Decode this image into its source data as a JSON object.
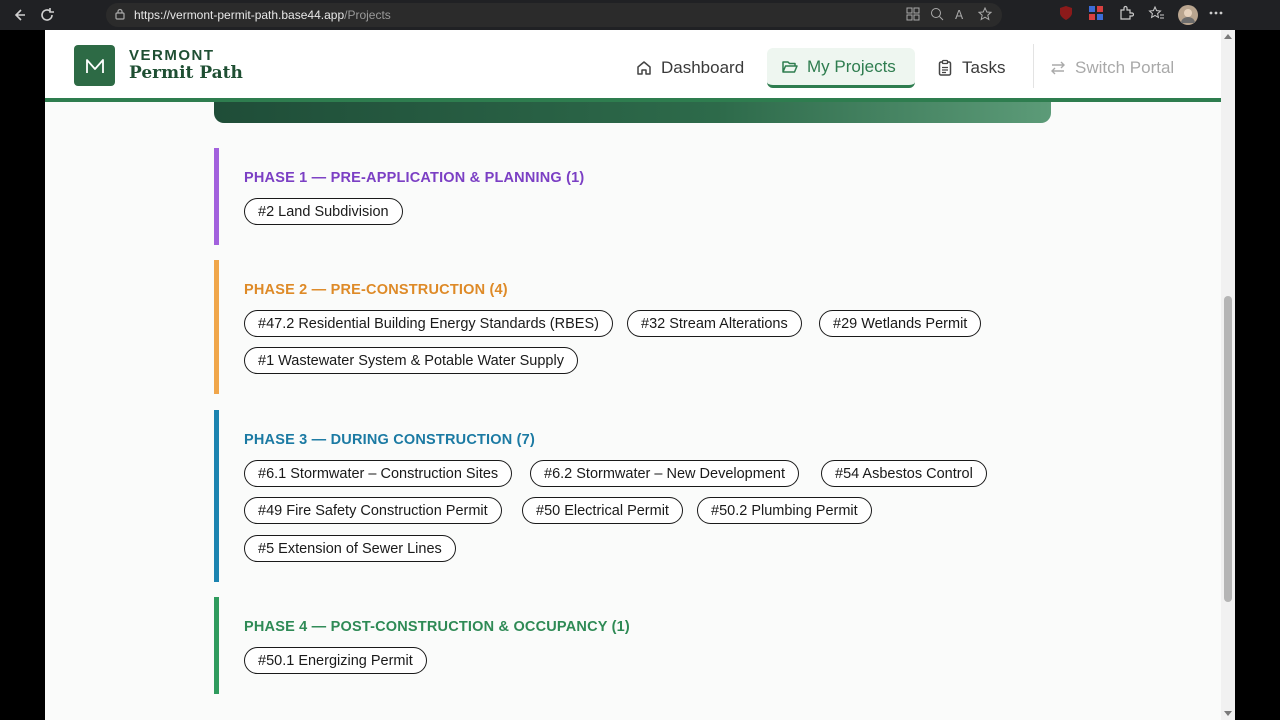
{
  "browser": {
    "url_host": "https://vermont-permit-path.base44.app",
    "url_path": "/Projects"
  },
  "brand": {
    "line1": "VERMONT",
    "line2": "Permit Path"
  },
  "nav": {
    "dashboard": "Dashboard",
    "my_projects": "My Projects",
    "tasks": "Tasks",
    "switch_portal": "Switch Portal"
  },
  "colors": {
    "brand_green": "#2e7d4f",
    "phase1": "#a261dd",
    "phase1_title": "#7b3fc4",
    "phase2": "#f0a64a",
    "phase2_title": "#de8a27",
    "phase3": "#1b84b0",
    "phase3_title": "#1b7aa3",
    "phase4": "#2f9b5d",
    "phase4_title": "#2e8a55"
  },
  "phases": [
    {
      "title": "PHASE 1 — PRE-APPLICATION & PLANNING (1)",
      "permits": [
        "#2 Land Subdivision"
      ]
    },
    {
      "title": "PHASE 2 — PRE-CONSTRUCTION (4)",
      "permits": [
        "#47.2 Residential Building Energy Standards (RBES)",
        "#32 Stream Alterations",
        "#29 Wetlands Permit",
        "#1 Wastewater System & Potable Water Supply"
      ]
    },
    {
      "title": "PHASE 3 — DURING CONSTRUCTION (7)",
      "permits": [
        "#6.1 Stormwater – Construction Sites",
        "#6.2 Stormwater – New Development",
        "#54 Asbestos Control",
        "#49 Fire Safety Construction Permit",
        "#50 Electrical Permit",
        "#50.2 Plumbing Permit",
        "#5 Extension of Sewer Lines"
      ]
    },
    {
      "title": "PHASE 4 — POST-CONSTRUCTION & OCCUPANCY (1)",
      "permits": [
        "#50.1 Energizing Permit"
      ]
    }
  ]
}
